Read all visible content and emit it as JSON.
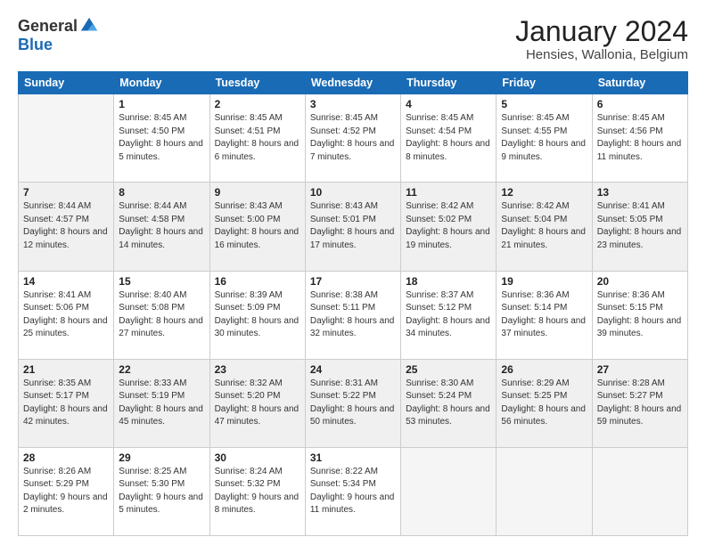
{
  "logo": {
    "general": "General",
    "blue": "Blue"
  },
  "title": "January 2024",
  "subtitle": "Hensies, Wallonia, Belgium",
  "header": {
    "days": [
      "Sunday",
      "Monday",
      "Tuesday",
      "Wednesday",
      "Thursday",
      "Friday",
      "Saturday"
    ]
  },
  "weeks": [
    {
      "shaded": false,
      "days": [
        {
          "num": "",
          "empty": true,
          "sunrise": "",
          "sunset": "",
          "daylight": ""
        },
        {
          "num": "1",
          "empty": false,
          "sunrise": "Sunrise: 8:45 AM",
          "sunset": "Sunset: 4:50 PM",
          "daylight": "Daylight: 8 hours and 5 minutes."
        },
        {
          "num": "2",
          "empty": false,
          "sunrise": "Sunrise: 8:45 AM",
          "sunset": "Sunset: 4:51 PM",
          "daylight": "Daylight: 8 hours and 6 minutes."
        },
        {
          "num": "3",
          "empty": false,
          "sunrise": "Sunrise: 8:45 AM",
          "sunset": "Sunset: 4:52 PM",
          "daylight": "Daylight: 8 hours and 7 minutes."
        },
        {
          "num": "4",
          "empty": false,
          "sunrise": "Sunrise: 8:45 AM",
          "sunset": "Sunset: 4:54 PM",
          "daylight": "Daylight: 8 hours and 8 minutes."
        },
        {
          "num": "5",
          "empty": false,
          "sunrise": "Sunrise: 8:45 AM",
          "sunset": "Sunset: 4:55 PM",
          "daylight": "Daylight: 8 hours and 9 minutes."
        },
        {
          "num": "6",
          "empty": false,
          "sunrise": "Sunrise: 8:45 AM",
          "sunset": "Sunset: 4:56 PM",
          "daylight": "Daylight: 8 hours and 11 minutes."
        }
      ]
    },
    {
      "shaded": true,
      "days": [
        {
          "num": "7",
          "empty": false,
          "sunrise": "Sunrise: 8:44 AM",
          "sunset": "Sunset: 4:57 PM",
          "daylight": "Daylight: 8 hours and 12 minutes."
        },
        {
          "num": "8",
          "empty": false,
          "sunrise": "Sunrise: 8:44 AM",
          "sunset": "Sunset: 4:58 PM",
          "daylight": "Daylight: 8 hours and 14 minutes."
        },
        {
          "num": "9",
          "empty": false,
          "sunrise": "Sunrise: 8:43 AM",
          "sunset": "Sunset: 5:00 PM",
          "daylight": "Daylight: 8 hours and 16 minutes."
        },
        {
          "num": "10",
          "empty": false,
          "sunrise": "Sunrise: 8:43 AM",
          "sunset": "Sunset: 5:01 PM",
          "daylight": "Daylight: 8 hours and 17 minutes."
        },
        {
          "num": "11",
          "empty": false,
          "sunrise": "Sunrise: 8:42 AM",
          "sunset": "Sunset: 5:02 PM",
          "daylight": "Daylight: 8 hours and 19 minutes."
        },
        {
          "num": "12",
          "empty": false,
          "sunrise": "Sunrise: 8:42 AM",
          "sunset": "Sunset: 5:04 PM",
          "daylight": "Daylight: 8 hours and 21 minutes."
        },
        {
          "num": "13",
          "empty": false,
          "sunrise": "Sunrise: 8:41 AM",
          "sunset": "Sunset: 5:05 PM",
          "daylight": "Daylight: 8 hours and 23 minutes."
        }
      ]
    },
    {
      "shaded": false,
      "days": [
        {
          "num": "14",
          "empty": false,
          "sunrise": "Sunrise: 8:41 AM",
          "sunset": "Sunset: 5:06 PM",
          "daylight": "Daylight: 8 hours and 25 minutes."
        },
        {
          "num": "15",
          "empty": false,
          "sunrise": "Sunrise: 8:40 AM",
          "sunset": "Sunset: 5:08 PM",
          "daylight": "Daylight: 8 hours and 27 minutes."
        },
        {
          "num": "16",
          "empty": false,
          "sunrise": "Sunrise: 8:39 AM",
          "sunset": "Sunset: 5:09 PM",
          "daylight": "Daylight: 8 hours and 30 minutes."
        },
        {
          "num": "17",
          "empty": false,
          "sunrise": "Sunrise: 8:38 AM",
          "sunset": "Sunset: 5:11 PM",
          "daylight": "Daylight: 8 hours and 32 minutes."
        },
        {
          "num": "18",
          "empty": false,
          "sunrise": "Sunrise: 8:37 AM",
          "sunset": "Sunset: 5:12 PM",
          "daylight": "Daylight: 8 hours and 34 minutes."
        },
        {
          "num": "19",
          "empty": false,
          "sunrise": "Sunrise: 8:36 AM",
          "sunset": "Sunset: 5:14 PM",
          "daylight": "Daylight: 8 hours and 37 minutes."
        },
        {
          "num": "20",
          "empty": false,
          "sunrise": "Sunrise: 8:36 AM",
          "sunset": "Sunset: 5:15 PM",
          "daylight": "Daylight: 8 hours and 39 minutes."
        }
      ]
    },
    {
      "shaded": true,
      "days": [
        {
          "num": "21",
          "empty": false,
          "sunrise": "Sunrise: 8:35 AM",
          "sunset": "Sunset: 5:17 PM",
          "daylight": "Daylight: 8 hours and 42 minutes."
        },
        {
          "num": "22",
          "empty": false,
          "sunrise": "Sunrise: 8:33 AM",
          "sunset": "Sunset: 5:19 PM",
          "daylight": "Daylight: 8 hours and 45 minutes."
        },
        {
          "num": "23",
          "empty": false,
          "sunrise": "Sunrise: 8:32 AM",
          "sunset": "Sunset: 5:20 PM",
          "daylight": "Daylight: 8 hours and 47 minutes."
        },
        {
          "num": "24",
          "empty": false,
          "sunrise": "Sunrise: 8:31 AM",
          "sunset": "Sunset: 5:22 PM",
          "daylight": "Daylight: 8 hours and 50 minutes."
        },
        {
          "num": "25",
          "empty": false,
          "sunrise": "Sunrise: 8:30 AM",
          "sunset": "Sunset: 5:24 PM",
          "daylight": "Daylight: 8 hours and 53 minutes."
        },
        {
          "num": "26",
          "empty": false,
          "sunrise": "Sunrise: 8:29 AM",
          "sunset": "Sunset: 5:25 PM",
          "daylight": "Daylight: 8 hours and 56 minutes."
        },
        {
          "num": "27",
          "empty": false,
          "sunrise": "Sunrise: 8:28 AM",
          "sunset": "Sunset: 5:27 PM",
          "daylight": "Daylight: 8 hours and 59 minutes."
        }
      ]
    },
    {
      "shaded": false,
      "days": [
        {
          "num": "28",
          "empty": false,
          "sunrise": "Sunrise: 8:26 AM",
          "sunset": "Sunset: 5:29 PM",
          "daylight": "Daylight: 9 hours and 2 minutes."
        },
        {
          "num": "29",
          "empty": false,
          "sunrise": "Sunrise: 8:25 AM",
          "sunset": "Sunset: 5:30 PM",
          "daylight": "Daylight: 9 hours and 5 minutes."
        },
        {
          "num": "30",
          "empty": false,
          "sunrise": "Sunrise: 8:24 AM",
          "sunset": "Sunset: 5:32 PM",
          "daylight": "Daylight: 9 hours and 8 minutes."
        },
        {
          "num": "31",
          "empty": false,
          "sunrise": "Sunrise: 8:22 AM",
          "sunset": "Sunset: 5:34 PM",
          "daylight": "Daylight: 9 hours and 11 minutes."
        },
        {
          "num": "",
          "empty": true,
          "sunrise": "",
          "sunset": "",
          "daylight": ""
        },
        {
          "num": "",
          "empty": true,
          "sunrise": "",
          "sunset": "",
          "daylight": ""
        },
        {
          "num": "",
          "empty": true,
          "sunrise": "",
          "sunset": "",
          "daylight": ""
        }
      ]
    }
  ]
}
